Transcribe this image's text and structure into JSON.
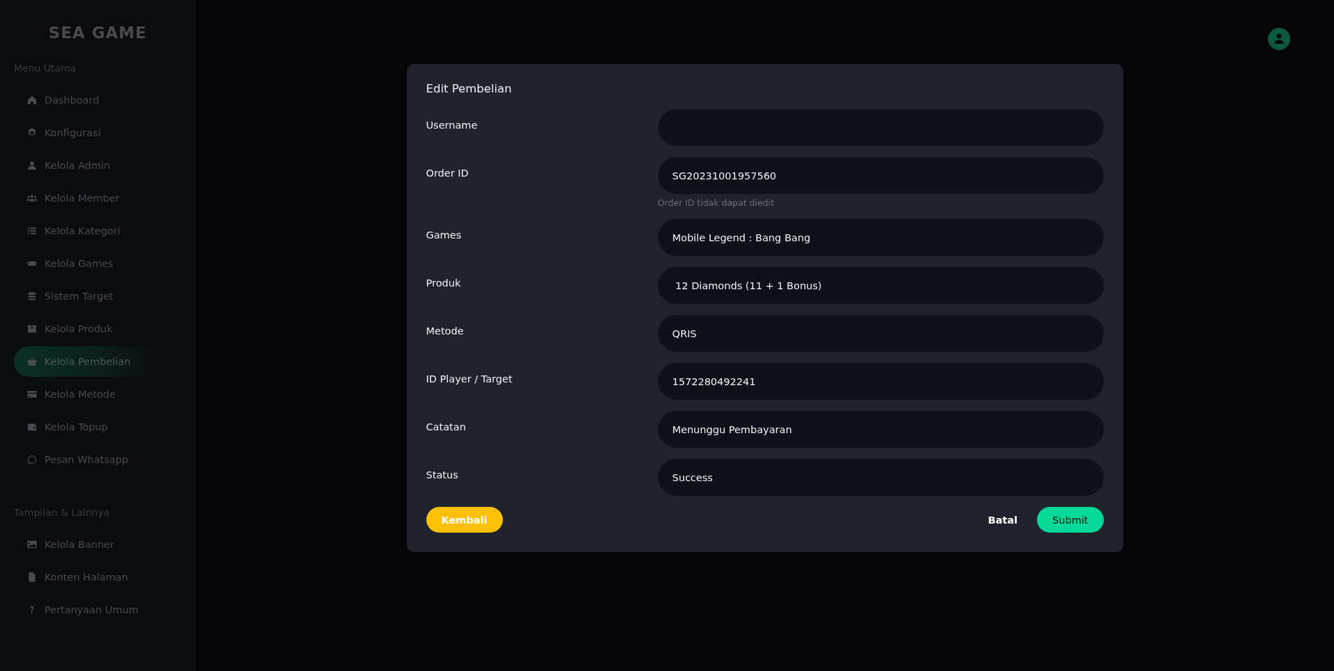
{
  "sidebar": {
    "logo": "SEA GAME",
    "sections": [
      {
        "title": "Menu Utama",
        "items": [
          {
            "label": "Dashboard",
            "selected": false
          },
          {
            "label": "Konfigurasi",
            "selected": false
          },
          {
            "label": "Kelola Admin",
            "selected": false
          },
          {
            "label": "Kelola Member",
            "selected": false
          },
          {
            "label": "Kelola Kategori",
            "selected": false
          },
          {
            "label": "Kelola Games",
            "selected": false
          },
          {
            "label": "Sistem Target",
            "selected": false
          },
          {
            "label": "Kelola Produk",
            "selected": false
          },
          {
            "label": "Kelola Pembelian",
            "selected": true
          },
          {
            "label": "Kelola Metode",
            "selected": false
          },
          {
            "label": "Kelola Topup",
            "selected": false
          },
          {
            "label": "Pesan Whatsapp",
            "selected": false
          }
        ]
      },
      {
        "title": "Tampilan & Lainnya",
        "items": [
          {
            "label": "Kelola Banner",
            "selected": false
          },
          {
            "label": "Konten Halaman",
            "selected": false
          },
          {
            "label": "Pertanyaan Umum",
            "selected": false
          }
        ]
      }
    ]
  },
  "modal": {
    "title": "Edit Pembelian",
    "fields": [
      {
        "label": "Username"
      },
      {
        "label": "Order ID",
        "value": "SG20231001957560",
        "hint": "Order ID tidak dapat diedit"
      },
      {
        "label": "Games",
        "value": "Mobile Legend : Bang Bang"
      },
      {
        "label": "Produk",
        "value": " 12 Diamonds (11 + 1 Bonus)"
      },
      {
        "label": "Metode",
        "value": "QRIS"
      },
      {
        "label": "ID Player / Target",
        "value": "1572280492241"
      },
      {
        "label": "Catatan",
        "value": "Menunggu Pembayaran"
      },
      {
        "label": "Status",
        "value": "Success"
      }
    ],
    "back_button": "Kembali",
    "cancel_button": "Batal",
    "submit_button": "Submit"
  }
}
